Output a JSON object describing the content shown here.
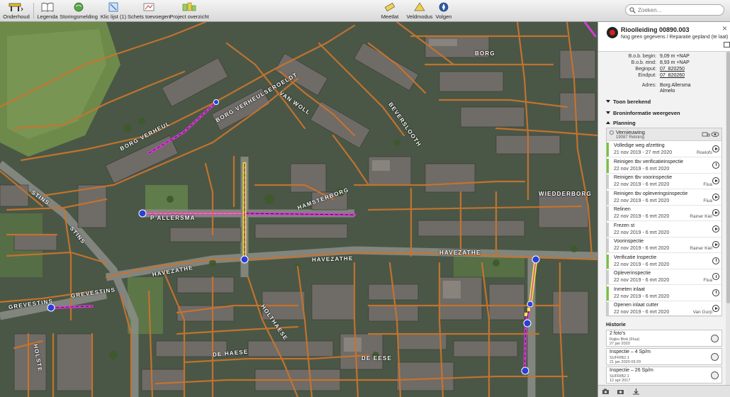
{
  "toolbar": {
    "items": [
      {
        "label": "Onderhoud"
      },
      {
        "label": "Legenda"
      },
      {
        "label": "Storingsmelding"
      },
      {
        "label": "Klic lijst (1)"
      },
      {
        "label": "Schets toevoegen"
      },
      {
        "label": "Project overzicht"
      },
      {
        "label": "Meetlat"
      },
      {
        "label": "Veldmodus"
      },
      {
        "label": "Volgen"
      }
    ],
    "search_placeholder": "Zoeken..."
  },
  "map": {
    "street_labels": [
      "WIEDDERBORG",
      "HAVEZATHE",
      "HAVEZATHE",
      "HAVEZATHE",
      "GREVESTINS",
      "GREVESTINS",
      "DE HAESE",
      "DE EESE",
      "HAMSTERBORG",
      "STINS",
      "STINS",
      "BORG VERHEUL",
      "BORG VERHEULSEROELDT",
      "P ALLERSMA",
      "VAN WOLL",
      "BEVERSLOOTH",
      "HOLTHAESE",
      "HOLSTE",
      "BORG"
    ]
  },
  "panel": {
    "title": "Rioolleiding 00890.003",
    "subtitle": "Nog geen gegevens / Reparatie gepland (te laat)",
    "props": [
      {
        "k": "B.o.b. begin:",
        "v": "9,09  m +NAP"
      },
      {
        "k": "B.o.b. eind:",
        "v": "8,93  m +NAP"
      },
      {
        "k": "Beginput:",
        "v": "07_820250"
      },
      {
        "k": "Eindput:",
        "v": "07_820260"
      },
      {
        "k": "Adres:",
        "v": "Borg Allersma"
      },
      {
        "k": "",
        "v": "Almelo"
      }
    ],
    "sections": {
      "toon_berekend": "Toon berekend",
      "broninformatie": "Broninformatie weergeven",
      "planning": "Planning",
      "historie": "Historie"
    },
    "planning": {
      "header": {
        "name": "Vernieuwing",
        "sub": "19087 Relining"
      },
      "rows": [
        {
          "name": "Volledige weg afzetting",
          "date": "21 nov 2019 - 27 mrt 2020",
          "person": "Roelofs",
          "status": "play"
        },
        {
          "name": "Reinigen tbv verificatieinspectie",
          "date": "22 nov 2019 - 6 mrt 2020",
          "person": "",
          "status": "warn"
        },
        {
          "name": "Reinigen tbv voorinspectie",
          "date": "22 nov 2019 - 6 mrt 2020",
          "person": "Flua",
          "status": "play"
        },
        {
          "name": "Reinigen tbv opleveringsinspectie",
          "date": "22 nov 2019 - 6 mrt 2020",
          "person": "Flua",
          "status": "play"
        },
        {
          "name": "Relinen",
          "date": "22 nov 2019 - 6 mrt 2020",
          "person": "Rainer Kiel",
          "status": "play"
        },
        {
          "name": "Frezen st",
          "date": "22 nov 2019 - 6 mrt 2020",
          "person": "",
          "status": "play"
        },
        {
          "name": "Voorinspectie",
          "date": "22 nov 2019 - 6 mrt 2020",
          "person": "Rainer Kiel",
          "status": "play"
        },
        {
          "name": "Verificatie Inspectie",
          "date": "22 nov 2019 - 6 mrt 2020",
          "person": "",
          "status": "warn"
        },
        {
          "name": "Opleverinspectie",
          "date": "22 nov 2019 - 6 mrt 2020",
          "person": "Flua",
          "status": "warn"
        },
        {
          "name": "Inmeten inlaat",
          "date": "22 nov 2019 - 6 mrt 2020",
          "person": "",
          "status": "warn"
        },
        {
          "name": "Openen inlaat cutter",
          "date": "22 nov 2019 - 6 mrt 2020",
          "person": "Van Gurp",
          "status": "play"
        }
      ]
    },
    "historie": [
      {
        "name": "2 foto's",
        "s1": "Rajko Blok (Flua)",
        "s2": "27 jan 2020"
      },
      {
        "name": "Inspectie – 4 Sp/m",
        "s1": "SUFRIB2.1",
        "s2": "21 jan 2020 09:29"
      },
      {
        "name": "Inspectie – 26 Sp/m",
        "s1": "SUFRIB2.1",
        "s2": "12 apr 2017"
      }
    ]
  },
  "colors": {
    "pipe": "#c8742e",
    "highlight": "#d63bd6",
    "yellow": "#e8e234",
    "node": "#2a3fd8",
    "green_bar": "#78c33b"
  }
}
